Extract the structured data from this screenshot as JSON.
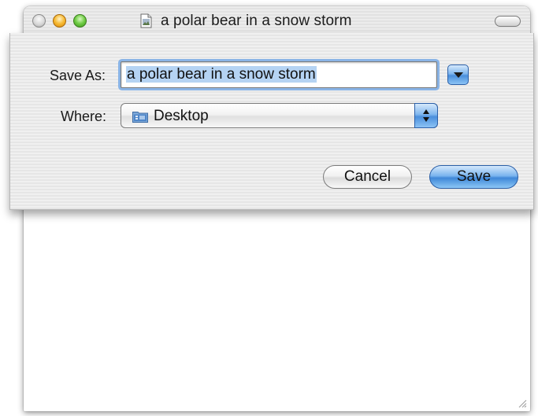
{
  "window": {
    "title": "a polar bear in a snow storm",
    "traffic_lights": {
      "close_color": "#d0d0d0",
      "minimize_color": "#f6b932",
      "zoom_color": "#6dcb42"
    },
    "proxy_icon": "document-icon",
    "toolbar_toggle_icon": "toolbar-pill-icon"
  },
  "save_sheet": {
    "save_as_label": "Save As:",
    "save_as_value": "a polar bear in a snow storm",
    "expand_icon": "disclosure-triangle-icon",
    "where_label": "Where:",
    "where_value": "Desktop",
    "where_icon": "desktop-folder-icon",
    "cancel_label": "Cancel",
    "save_label": "Save",
    "accent_color": "#4a8fdc"
  }
}
